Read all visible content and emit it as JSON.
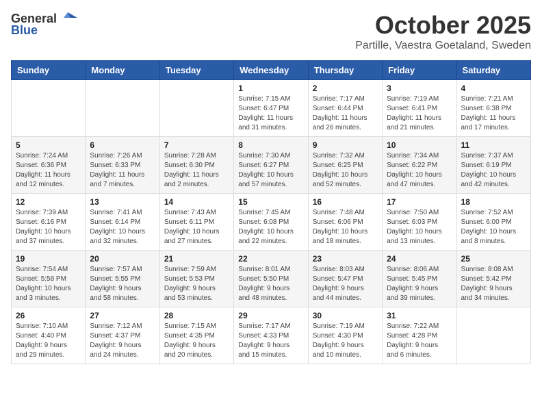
{
  "header": {
    "logo_general": "General",
    "logo_blue": "Blue",
    "month_title": "October 2025",
    "location": "Partille, Vaestra Goetaland, Sweden"
  },
  "weekdays": [
    "Sunday",
    "Monday",
    "Tuesday",
    "Wednesday",
    "Thursday",
    "Friday",
    "Saturday"
  ],
  "weeks": [
    [
      {
        "day": "",
        "info": ""
      },
      {
        "day": "",
        "info": ""
      },
      {
        "day": "",
        "info": ""
      },
      {
        "day": "1",
        "info": "Sunrise: 7:15 AM\nSunset: 6:47 PM\nDaylight: 11 hours\nand 31 minutes."
      },
      {
        "day": "2",
        "info": "Sunrise: 7:17 AM\nSunset: 6:44 PM\nDaylight: 11 hours\nand 26 minutes."
      },
      {
        "day": "3",
        "info": "Sunrise: 7:19 AM\nSunset: 6:41 PM\nDaylight: 11 hours\nand 21 minutes."
      },
      {
        "day": "4",
        "info": "Sunrise: 7:21 AM\nSunset: 6:38 PM\nDaylight: 11 hours\nand 17 minutes."
      }
    ],
    [
      {
        "day": "5",
        "info": "Sunrise: 7:24 AM\nSunset: 6:36 PM\nDaylight: 11 hours\nand 12 minutes."
      },
      {
        "day": "6",
        "info": "Sunrise: 7:26 AM\nSunset: 6:33 PM\nDaylight: 11 hours\nand 7 minutes."
      },
      {
        "day": "7",
        "info": "Sunrise: 7:28 AM\nSunset: 6:30 PM\nDaylight: 11 hours\nand 2 minutes."
      },
      {
        "day": "8",
        "info": "Sunrise: 7:30 AM\nSunset: 6:27 PM\nDaylight: 10 hours\nand 57 minutes."
      },
      {
        "day": "9",
        "info": "Sunrise: 7:32 AM\nSunset: 6:25 PM\nDaylight: 10 hours\nand 52 minutes."
      },
      {
        "day": "10",
        "info": "Sunrise: 7:34 AM\nSunset: 6:22 PM\nDaylight: 10 hours\nand 47 minutes."
      },
      {
        "day": "11",
        "info": "Sunrise: 7:37 AM\nSunset: 6:19 PM\nDaylight: 10 hours\nand 42 minutes."
      }
    ],
    [
      {
        "day": "12",
        "info": "Sunrise: 7:39 AM\nSunset: 6:16 PM\nDaylight: 10 hours\nand 37 minutes."
      },
      {
        "day": "13",
        "info": "Sunrise: 7:41 AM\nSunset: 6:14 PM\nDaylight: 10 hours\nand 32 minutes."
      },
      {
        "day": "14",
        "info": "Sunrise: 7:43 AM\nSunset: 6:11 PM\nDaylight: 10 hours\nand 27 minutes."
      },
      {
        "day": "15",
        "info": "Sunrise: 7:45 AM\nSunset: 6:08 PM\nDaylight: 10 hours\nand 22 minutes."
      },
      {
        "day": "16",
        "info": "Sunrise: 7:48 AM\nSunset: 6:06 PM\nDaylight: 10 hours\nand 18 minutes."
      },
      {
        "day": "17",
        "info": "Sunrise: 7:50 AM\nSunset: 6:03 PM\nDaylight: 10 hours\nand 13 minutes."
      },
      {
        "day": "18",
        "info": "Sunrise: 7:52 AM\nSunset: 6:00 PM\nDaylight: 10 hours\nand 8 minutes."
      }
    ],
    [
      {
        "day": "19",
        "info": "Sunrise: 7:54 AM\nSunset: 5:58 PM\nDaylight: 10 hours\nand 3 minutes."
      },
      {
        "day": "20",
        "info": "Sunrise: 7:57 AM\nSunset: 5:55 PM\nDaylight: 9 hours\nand 58 minutes."
      },
      {
        "day": "21",
        "info": "Sunrise: 7:59 AM\nSunset: 5:53 PM\nDaylight: 9 hours\nand 53 minutes."
      },
      {
        "day": "22",
        "info": "Sunrise: 8:01 AM\nSunset: 5:50 PM\nDaylight: 9 hours\nand 48 minutes."
      },
      {
        "day": "23",
        "info": "Sunrise: 8:03 AM\nSunset: 5:47 PM\nDaylight: 9 hours\nand 44 minutes."
      },
      {
        "day": "24",
        "info": "Sunrise: 8:06 AM\nSunset: 5:45 PM\nDaylight: 9 hours\nand 39 minutes."
      },
      {
        "day": "25",
        "info": "Sunrise: 8:08 AM\nSunset: 5:42 PM\nDaylight: 9 hours\nand 34 minutes."
      }
    ],
    [
      {
        "day": "26",
        "info": "Sunrise: 7:10 AM\nSunset: 4:40 PM\nDaylight: 9 hours\nand 29 minutes."
      },
      {
        "day": "27",
        "info": "Sunrise: 7:12 AM\nSunset: 4:37 PM\nDaylight: 9 hours\nand 24 minutes."
      },
      {
        "day": "28",
        "info": "Sunrise: 7:15 AM\nSunset: 4:35 PM\nDaylight: 9 hours\nand 20 minutes."
      },
      {
        "day": "29",
        "info": "Sunrise: 7:17 AM\nSunset: 4:33 PM\nDaylight: 9 hours\nand 15 minutes."
      },
      {
        "day": "30",
        "info": "Sunrise: 7:19 AM\nSunset: 4:30 PM\nDaylight: 9 hours\nand 10 minutes."
      },
      {
        "day": "31",
        "info": "Sunrise: 7:22 AM\nSunset: 4:28 PM\nDaylight: 9 hours\nand 6 minutes."
      },
      {
        "day": "",
        "info": ""
      }
    ]
  ]
}
